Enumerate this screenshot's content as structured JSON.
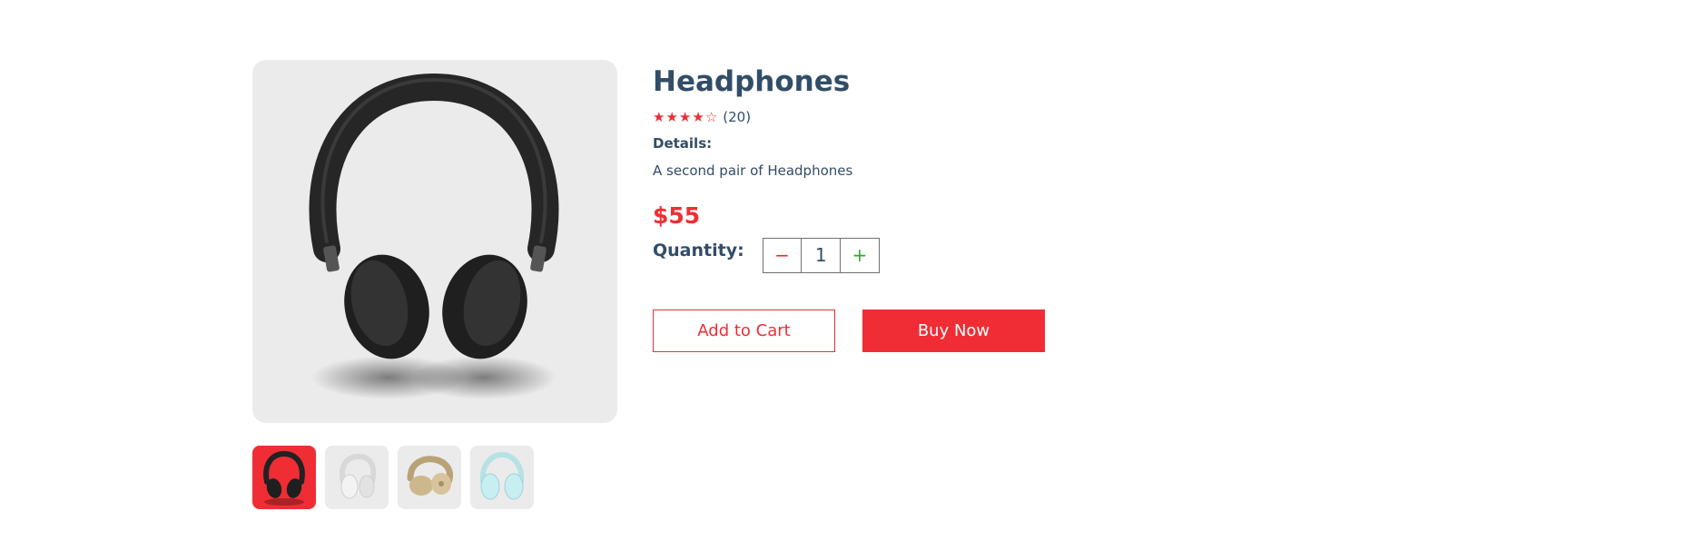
{
  "product": {
    "title": "Headphones",
    "rating_value": 4,
    "rating_max": 5,
    "review_count": "(20)",
    "details_label": "Details:",
    "description": "A second pair of Headphones",
    "price": "$55"
  },
  "quantity": {
    "label": "Quantity:",
    "minus": "−",
    "value": "1",
    "plus": "+"
  },
  "buttons": {
    "add_to_cart": "Add to Cart",
    "buy_now": "Buy Now"
  },
  "images": {
    "main": "black-headphones-image",
    "thumbnails": [
      {
        "name": "black-headphones-thumbnail",
        "selected": true
      },
      {
        "name": "white-headphones-thumbnail",
        "selected": false
      },
      {
        "name": "beige-headphones-thumbnail",
        "selected": false
      },
      {
        "name": "mint-headphones-thumbnail",
        "selected": false
      }
    ]
  },
  "colors": {
    "accent": "#f02d34",
    "text": "#324d67",
    "image_bg": "#ebebeb",
    "plus": "#31a831"
  }
}
